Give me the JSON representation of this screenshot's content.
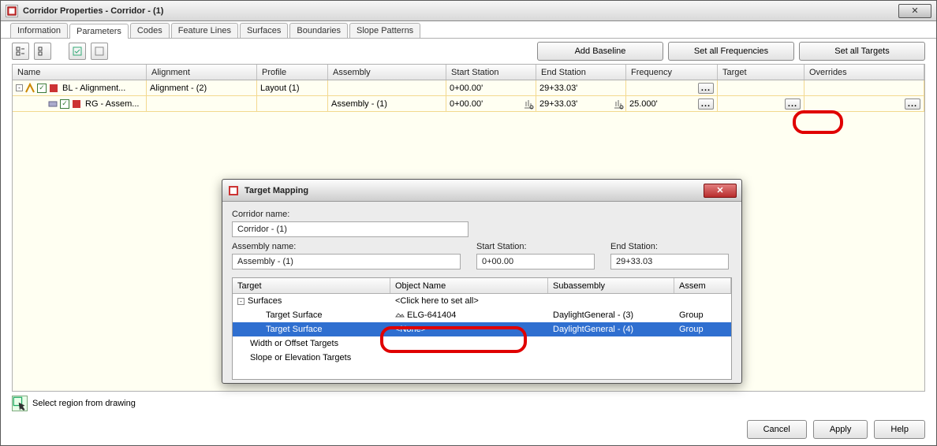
{
  "window": {
    "title": "Corridor Properties - Corridor - (1)"
  },
  "tabs": [
    "Information",
    "Parameters",
    "Codes",
    "Feature Lines",
    "Surfaces",
    "Boundaries",
    "Slope Patterns"
  ],
  "active_tab": 1,
  "buttons": {
    "add_baseline": "Add Baseline",
    "set_freq": "Set all Frequencies",
    "set_targets": "Set all Targets",
    "cancel": "Cancel",
    "apply": "Apply",
    "help": "Help"
  },
  "grid": {
    "headers": [
      "Name",
      "Alignment",
      "Profile",
      "Assembly",
      "Start Station",
      "End Station",
      "Frequency",
      "Target",
      "Overrides"
    ],
    "rows": [
      {
        "level": 0,
        "name": "BL - Alignment...",
        "alignment": "Alignment - (2)",
        "profile": "Layout (1)",
        "assembly": "",
        "sstn": "0+00.00'",
        "estn": "29+33.03'",
        "freq": "",
        "target": "",
        "over": "",
        "has_ellipsis_freq": true,
        "has_ellipsis_over": false
      },
      {
        "level": 1,
        "name": "RG - Assem...",
        "alignment": "",
        "profile": "",
        "assembly": "Assembly - (1)",
        "sstn": "0+00.00'",
        "estn": "29+33.03'",
        "freq": "25.000'",
        "target": "",
        "over": "",
        "has_ellipsis_freq": true,
        "has_ellipsis_over": true,
        "has_ellipsis_target": true,
        "station_icon": true
      }
    ]
  },
  "select_region": "Select region from drawing",
  "dialog": {
    "title": "Target Mapping",
    "labels": {
      "corridor": "Corridor name:",
      "assembly": "Assembly name:",
      "sstn": "Start Station:",
      "estn": "End Station:"
    },
    "values": {
      "corridor": "Corridor - (1)",
      "assembly": "Assembly - (1)",
      "sstn": "0+00.00",
      "estn": "29+33.03"
    },
    "columns": [
      "Target",
      "Object Name",
      "Subassembly",
      "Assem"
    ],
    "tree": {
      "surfaces": "Surfaces",
      "click_all": "<Click here to set all>",
      "rows": [
        {
          "target": "Target Surface",
          "obj": "ELG-641404",
          "sub": "DaylightGeneral - (3)",
          "asm": "Group",
          "sel": false
        },
        {
          "target": "Target Surface",
          "obj": "<None>",
          "sub": "DaylightGeneral - (4)",
          "asm": "Group",
          "sel": true
        }
      ],
      "width_targets": "Width or Offset Targets",
      "slope_targets": "Slope or Elevation Targets"
    }
  }
}
